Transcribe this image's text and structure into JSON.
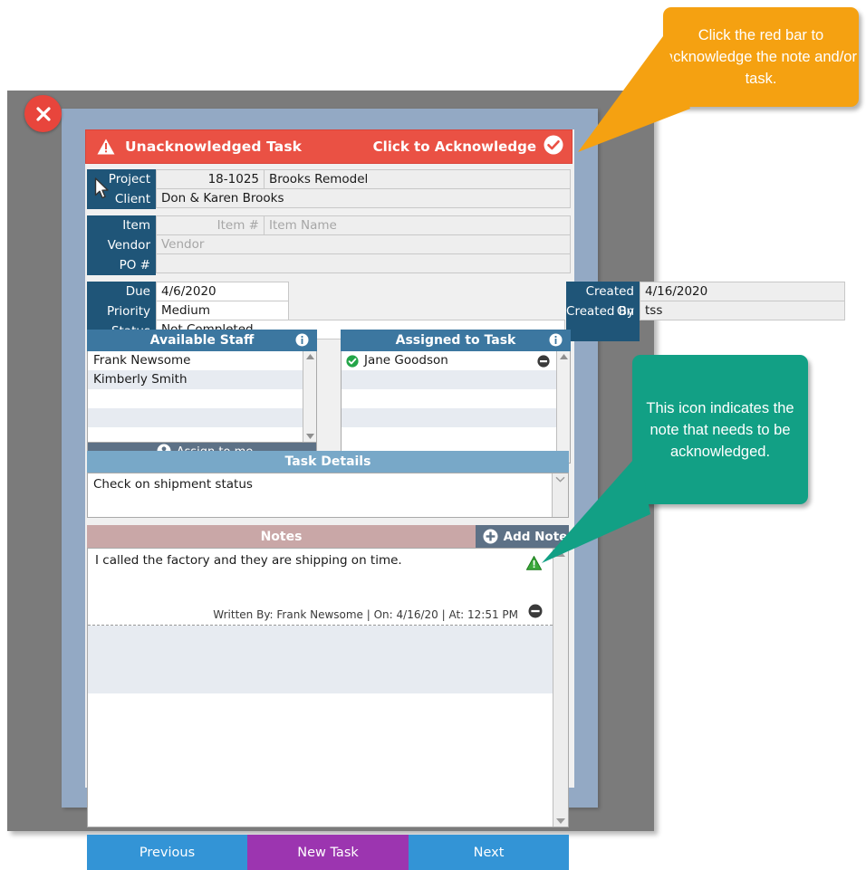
{
  "window": {
    "close_label": "×"
  },
  "ack_bar": {
    "title": "Unacknowledged Task",
    "action": "Click to Acknowledge",
    "warning_icon": "warning-triangle-icon",
    "check_icon": "check-circle-icon",
    "color": "#ea5144"
  },
  "project": {
    "label_project": "Project",
    "label_client": "Client",
    "number": "18-1025",
    "name": "Brooks Remodel",
    "client": "Don & Karen Brooks"
  },
  "item": {
    "label_item": "Item",
    "label_vendor": "Vendor",
    "label_po": "PO #",
    "item_number_placeholder": "Item #",
    "item_name_placeholder": "Item Name",
    "vendor_placeholder": "Vendor",
    "po_value": ""
  },
  "dates": {
    "label_due": "Due",
    "label_priority": "Priority",
    "label_status": "Status",
    "label_created_on": "Created On",
    "label_created_by": "Created By",
    "due": "4/6/2020",
    "priority": "Medium",
    "status": "Not Completed",
    "created_on": "4/16/2020",
    "created_by": "tss"
  },
  "available_staff": {
    "title": "Available Staff",
    "info_icon": "info-icon",
    "rows": [
      "Frank Newsome",
      "Kimberly Smith",
      "",
      ""
    ],
    "assign_label": "Assign to me",
    "assign_icon": "person-icon"
  },
  "assigned_staff": {
    "title": "Assigned to Task",
    "info_icon": "info-icon",
    "rows": [
      "Jane Goodson",
      "",
      "",
      "",
      ""
    ],
    "status_icon": "green-check-icon",
    "remove_icon": "remove-circle-icon"
  },
  "task_details": {
    "title": "Task Details",
    "text": "Check on shipment status"
  },
  "notes": {
    "title": "Notes",
    "add_label": "Add Note",
    "add_icon": "plus-circle-icon",
    "items": [
      {
        "text": "I called the factory and they are shipping on time.",
        "meta": "Written By: Frank Newsome | On:  4/16/20 | At: 12:51 PM",
        "warn_icon": "green-warning-triangle-icon",
        "remove_icon": "remove-circle-icon"
      }
    ]
  },
  "buttons": {
    "previous": "Previous",
    "new_task": "New Task",
    "next": "Next"
  },
  "callouts": {
    "orange": {
      "text": "Click the red bar to acknowledge the note and/or task.",
      "color": "#f5a111"
    },
    "green": {
      "text": "This icon indicates the note that needs to be acknowledged.",
      "color": "#12a085"
    }
  }
}
